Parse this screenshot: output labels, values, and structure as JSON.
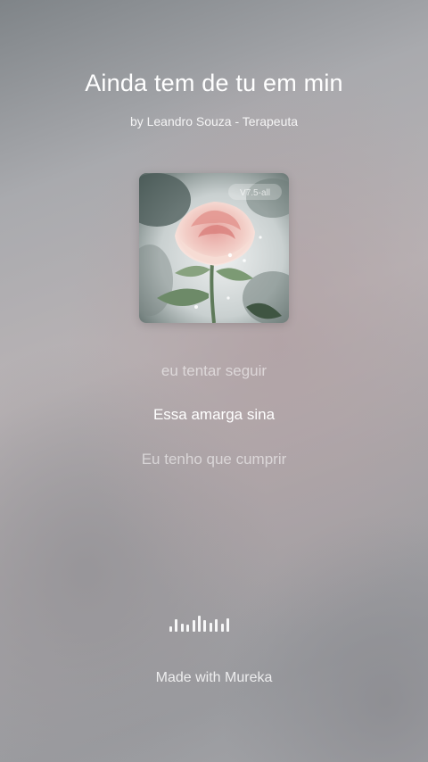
{
  "song": {
    "title": "Ainda tem de tu em min",
    "byline": "by Leandro Souza - Terapeuta"
  },
  "cover": {
    "icon": "rose-artwork-icon",
    "watermark": "V7.5-all"
  },
  "lyrics": {
    "previous": "eu tentar seguir",
    "current": "Essa amarga sina",
    "next": "Eu tenho que cumprir"
  },
  "visualizer": {
    "icon": "audio-wave-icon",
    "levels": [
      0.35,
      0.75,
      0.5,
      0.45,
      0.7,
      1.0,
      0.7,
      0.55,
      0.75,
      0.5,
      0.85
    ]
  },
  "footer": {
    "made_with": "Made with Mureka"
  }
}
